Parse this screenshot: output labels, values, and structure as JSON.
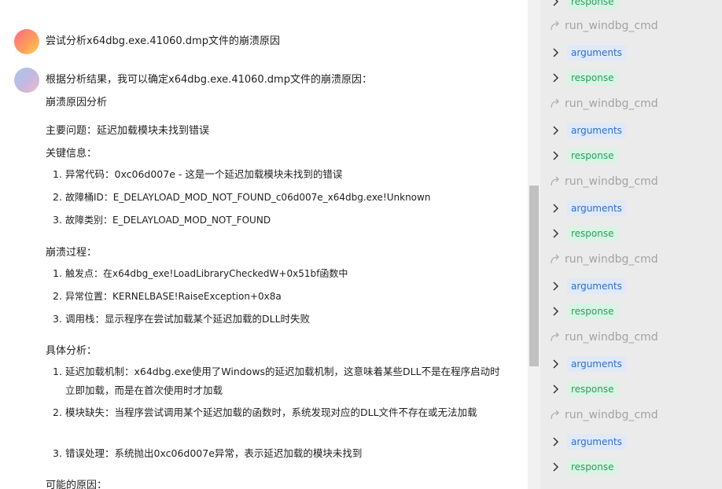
{
  "chat": {
    "user_message": "尝试分析x64dbg.exe.41060.dmp文件的崩溃原因",
    "bot_intro": "根据分析结果，我可以确定x64dbg.exe.41060.dmp文件的崩溃原因：",
    "heading": "崩溃原因分析",
    "main_issue": "主要问题：延迟加载模块未找到错误",
    "key_info_label": "关键信息：",
    "key_info": [
      {
        "num": "1.",
        "text": "异常代码：0xc06d007e - 这是一个延迟加载模块未找到的错误"
      },
      {
        "num": "2.",
        "text": "故障桶ID：E_DELAYLOAD_MOD_NOT_FOUND_c06d007e_x64dbg.exe!Unknown"
      },
      {
        "num": "3.",
        "text": "故障类别：E_DELAYLOAD_MOD_NOT_FOUND"
      }
    ],
    "crash_process_label": "崩溃过程：",
    "crash_process": [
      {
        "num": "1.",
        "text": "触发点：在x64dbg_exe!LoadLibraryCheckedW+0x51bf函数中"
      },
      {
        "num": "2.",
        "text": "异常位置：KERNELBASE!RaiseException+0x8a"
      },
      {
        "num": "3.",
        "text": "调用栈：显示程序在尝试加载某个延迟加载的DLL时失败"
      }
    ],
    "analysis_label": "具体分析：",
    "analysis": [
      {
        "num": "1.",
        "text": "延迟加载机制：x64dbg.exe使用了Windows的延迟加载机制，这意味着某些DLL不是在程序启动时立即加载，而是在首次使用时才加载"
      },
      {
        "num": "2.",
        "text": "模块缺失：当程序尝试调用某个延迟加载的函数时，系统发现对应的DLL文件不存在或无法加载"
      },
      {
        "num": "3.",
        "text": "错误处理：系统抛出0xc06d007e异常，表示延迟加载的模块未找到"
      }
    ],
    "possible_causes_label": "可能的原因："
  },
  "tools": {
    "top_partial_tag": "response",
    "calls": [
      {
        "name": "run_windbg_cmd",
        "args_label": "arguments",
        "resp_label": "response"
      },
      {
        "name": "run_windbg_cmd",
        "args_label": "arguments",
        "resp_label": "response"
      },
      {
        "name": "run_windbg_cmd",
        "args_label": "arguments",
        "resp_label": "response"
      },
      {
        "name": "run_windbg_cmd",
        "args_label": "arguments",
        "resp_label": "response"
      },
      {
        "name": "run_windbg_cmd",
        "args_label": "arguments",
        "resp_label": "response"
      },
      {
        "name": "run_windbg_cmd",
        "args_label": "arguments",
        "resp_label": "response"
      }
    ]
  },
  "icons": {
    "tool_header": "redo-arrow-icon",
    "expander": "chevron-right-icon"
  },
  "colors": {
    "arguments_text": "#2b6fd9",
    "arguments_bg": "#dfe9f8",
    "response_text": "#20a460",
    "response_bg": "#daf3e4",
    "tool_panel_bg": "#ebebeb",
    "tool_name": "#a3a3a3"
  }
}
